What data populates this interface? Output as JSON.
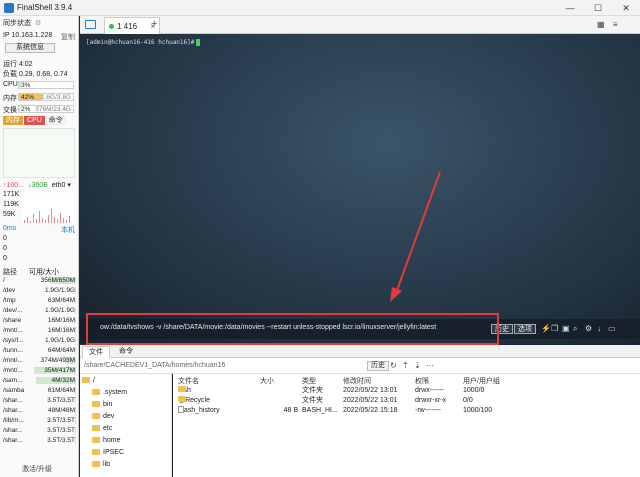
{
  "window": {
    "title": "FinalShell 3.9.4",
    "minimize": "—",
    "maximize": "☐",
    "close": "✕"
  },
  "sidebar": {
    "sync_status": "同步状态",
    "ip_label": "IP 10.163.1.228",
    "copy": "复制",
    "sysinfo_button": "系统信息",
    "uptime": "运行 4:02",
    "load": "负载 0.29, 0.68, 0.74",
    "cpu": {
      "label": "CPU",
      "value": "3%",
      "percent": 3
    },
    "mem": {
      "label": "内存",
      "value": "42%",
      "detail": "1.6G/3.8G",
      "percent": 42
    },
    "swap": {
      "label": "交换",
      "value": "2%",
      "detail": "376M/23.4G",
      "percent": 2
    },
    "tabs": {
      "mem": "内存",
      "cpu": "CPU",
      "cmd": "命令"
    },
    "net": {
      "up": "↑100...",
      "down": "↓360B",
      "iface": "eth0 ▾",
      "scale": [
        "171K",
        "119K",
        "59K"
      ]
    },
    "latency": {
      "value": "0ms",
      "host": "本机",
      "rows": [
        "0",
        "0",
        "0"
      ]
    },
    "disk_header": {
      "path": "路径",
      "avail": "可用/大小"
    },
    "disks": [
      {
        "path": "/",
        "usage": "356M/650M",
        "percent": 55
      },
      {
        "path": "/dev",
        "usage": "1.9G/1.9G",
        "percent": 2
      },
      {
        "path": "/tmp",
        "usage": "63M/64M",
        "percent": 2
      },
      {
        "path": "/dev/...",
        "usage": "1.9G/1.9G",
        "percent": 2
      },
      {
        "path": "/share",
        "usage": "16M/16M",
        "percent": 2
      },
      {
        "path": "/mnt/...",
        "usage": "16M/16M",
        "percent": 2
      },
      {
        "path": "/sys/f...",
        "usage": "1.9G/1.9G",
        "percent": 2
      },
      {
        "path": "/tunn...",
        "usage": "64M/64M",
        "percent": 2
      },
      {
        "path": "/mnt/...",
        "usage": "374M/493M",
        "percent": 24
      },
      {
        "path": "/mnt/...",
        "usage": "35M/417M",
        "percent": 92
      },
      {
        "path": "/sam...",
        "usage": "4M/32M",
        "percent": 88
      },
      {
        "path": "/samba",
        "usage": "61M/64M",
        "percent": 5
      },
      {
        "path": "/shar...",
        "usage": "3.5T/3.5T",
        "percent": 2
      },
      {
        "path": "/shar...",
        "usage": "48M/48M",
        "percent": 2
      },
      {
        "path": "/lib/m...",
        "usage": "3.5T/3.5T",
        "percent": 2
      },
      {
        "path": "/shar...",
        "usage": "3.5T/3.5T",
        "percent": 2
      },
      {
        "path": "/shar...",
        "usage": "3.5T/3.5T",
        "percent": 2
      }
    ],
    "footer": "激活/升级"
  },
  "tabbar": {
    "tab_label": "1 416",
    "close": "×",
    "add": "+"
  },
  "terminal": {
    "prompt": "[admin@hchuan16-416 hchuan16]#",
    "command": "ow:/data/tvshows   -v /share/DATA/movie:/data/movies   --restart unless-stopped   lscr.io/linuxserver/jellyfin:latest",
    "history_button": "历史",
    "options_button": "选项"
  },
  "filepanel": {
    "tabs": {
      "files": "文件",
      "commands": "命令"
    },
    "path": "/share/CACHEDEV1_DATA/homes/hchuan16",
    "history_button": "历史",
    "tree_root": "/",
    "tree": [
      ".system",
      "bin",
      "dev",
      "etc",
      "home",
      "IPSEC",
      "lib"
    ],
    "headers": {
      "name": "文件名",
      "size": "大小",
      "type": "类型",
      "mtime": "修改时间",
      "perm": "权限",
      "owner": "用户/用户组"
    },
    "files": [
      {
        "name": ".ssh",
        "size": "",
        "type": "文件夹",
        "mtime": "2022/05/22 13:01",
        "perm": "drwx------",
        "owner": "1000/0",
        "folder": true
      },
      {
        "name": "@Recycle",
        "size": "",
        "type": "文件夹",
        "mtime": "2022/05/22 13:01",
        "perm": "drwxr-xr-x",
        "owner": "0/0",
        "folder": true
      },
      {
        "name": ".bash_history",
        "size": "48 B",
        "type": "BASH_HI...",
        "mtime": "2022/05/22 15:18",
        "perm": "-rw-------",
        "owner": "1000/100",
        "folder": false
      }
    ]
  },
  "colors": {
    "accent": "#1e7ec9",
    "mem_fill": "#f6c15c",
    "cpu_tab": "#d9534f",
    "mem_tab": "#e0a33b",
    "highlight": "#e23b3b",
    "arrow": "#e23b3b"
  }
}
